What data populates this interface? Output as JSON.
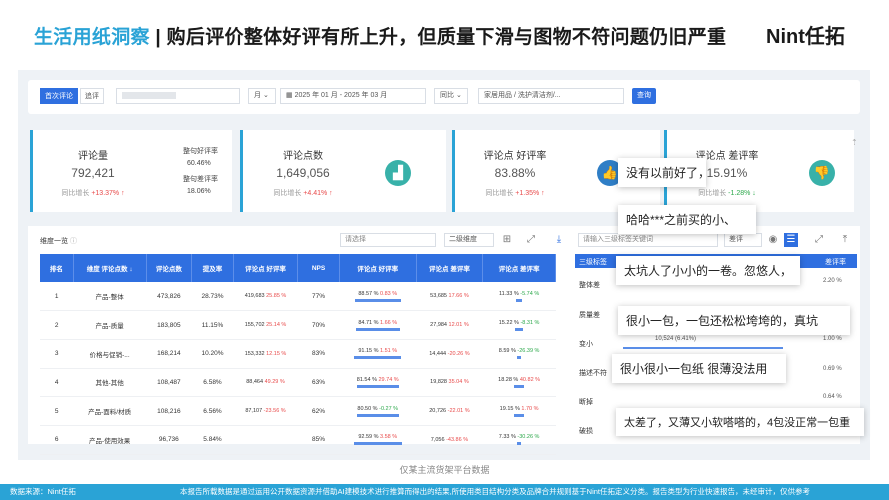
{
  "header": {
    "title_highlight": "生活用纸洞察",
    "title_sep": "|",
    "title_rest": "购后评价整体好评有所上升，但质量下滑与图物不符问题仍旧严重",
    "logo": "Nint任拓"
  },
  "filters": {
    "tab_first": "首次评论",
    "tab_follow": "追评",
    "period": "月",
    "date_start": "2025 年 01 月",
    "date_sep": "-",
    "date_end": "2025 年 03 月",
    "compare": "同比",
    "category": "家居用品 / 洗护清洁剂/...",
    "query_button": "查询"
  },
  "cards": [
    {
      "title": "评论量",
      "value": "792,421",
      "compare_label": "同比增长",
      "compare_value": "+13.37%",
      "trend": "up",
      "side": [
        {
          "label": "整句好评率",
          "value": "60.46%"
        },
        {
          "label": "整句差评率",
          "value": "18.06%"
        }
      ]
    },
    {
      "title": "评论点数",
      "value": "1,649,056",
      "compare_label": "同比增长",
      "compare_value": "+4.41%",
      "trend": "up",
      "icon": "chart-icon"
    },
    {
      "title": "评论点 好评率",
      "value": "83.88%",
      "compare_label": "同比增长",
      "compare_value": "+1.35%",
      "trend": "up",
      "icon": "thumbs-up-icon"
    },
    {
      "title": "评论点 差评率",
      "value": "15.91%",
      "compare_label": "同比增长",
      "compare_value": "-1.28%",
      "trend": "down",
      "icon": "thumbs-down-icon"
    }
  ],
  "table": {
    "section_label": "维度一览",
    "select_placeholder": "请选择",
    "dimension_select": "二级维度",
    "columns": [
      "排名",
      "维度 评论点数",
      "评论点数",
      "提及率",
      "评论点 好评率",
      "NPS",
      "评论点 好评率",
      "评论点 差评率",
      "评论点 差评率"
    ],
    "rows": [
      {
        "rank": "1",
        "name": "产品-整体",
        "count": "473,826",
        "mention": "28.73%",
        "good_cnt": "419,683",
        "good_rate": "25.85 %",
        "nps": "77%",
        "good_bar": "88.57 %",
        "good_delta": "0.83 %",
        "bad_cnt": "53,685",
        "bad_rate": "17.66 %",
        "bad_bar": "11.33 %",
        "bad_delta": "-5.74 %"
      },
      {
        "rank": "2",
        "name": "产品-质量",
        "count": "183,805",
        "mention": "11.15%",
        "good_cnt": "155,702",
        "good_rate": "25.14 %",
        "nps": "70%",
        "good_bar": "84.71 %",
        "good_delta": "1.66 %",
        "bad_cnt": "27,984",
        "bad_rate": "12.01 %",
        "bad_bar": "15.22 %",
        "bad_delta": "-8.31 %"
      },
      {
        "rank": "3",
        "name": "价格与促销-...",
        "count": "168,214",
        "mention": "10.20%",
        "good_cnt": "153,332",
        "good_rate": "12.15 %",
        "nps": "83%",
        "good_bar": "91.15 %",
        "good_delta": "1.51 %",
        "bad_cnt": "14,444",
        "bad_rate": "-20.26 %",
        "bad_bar": "8.59 %",
        "bad_delta": "-26.39 %"
      },
      {
        "rank": "4",
        "name": "其他-其他",
        "count": "108,487",
        "mention": "6.58%",
        "good_cnt": "88,464",
        "good_rate": "49.29 %",
        "nps": "63%",
        "good_bar": "81.54 %",
        "good_delta": "29.74 %",
        "bad_cnt": "19,828",
        "bad_rate": "35.04 %",
        "bad_bar": "18.28 %",
        "bad_delta": "40.82 %"
      },
      {
        "rank": "5",
        "name": "产品-面料/材质",
        "count": "108,216",
        "mention": "6.56%",
        "good_cnt": "87,107",
        "good_rate": "-23.56 %",
        "nps": "62%",
        "good_bar": "80.50 %",
        "good_delta": "-0.27 %",
        "bad_cnt": "20,726",
        "bad_rate": "-22.01 %",
        "bad_bar": "19.15 %",
        "bad_delta": "1.70 %"
      },
      {
        "rank": "6",
        "name": "产品-使用效果",
        "count": "96,736",
        "mention": "5.84%",
        "good_cnt": "",
        "good_rate": "",
        "nps": "85%",
        "good_bar": "92.59 %",
        "good_delta": "3.58 %",
        "bad_cnt": "7,056",
        "bad_rate": "-43.86 %",
        "bad_bar": "7.33 %",
        "bad_delta": "-30.26 %"
      }
    ]
  },
  "right_panel": {
    "search_placeholder": "请输入三级标签关键词",
    "sort_select": "差评",
    "header_label": "三级标签",
    "header_right": "差评率",
    "rows": [
      {
        "label": "整体差",
        "value": "2.20 %"
      },
      {
        "label": "质量差",
        "value": ""
      },
      {
        "label": "变小",
        "value": "1.00 %",
        "sub": "10,524 (6.41%)"
      },
      {
        "label": "描述不符",
        "value": "0.69 %"
      },
      {
        "label": "断掉",
        "value": "0.64 %"
      },
      {
        "label": "破损",
        "value": ""
      }
    ]
  },
  "bubbles": [
    "没有以前好了，",
    "哈哈***之前买的小、",
    "太坑人了小小的一卷。忽悠人，",
    "很小一包，一包还松松垮垮的，真坑",
    "很小很小一包纸 很薄没法用",
    "太差了，又薄又小软嗒嗒的，4包没正常一包重"
  ],
  "source_note": "仅某主流货架平台数据",
  "footer": {
    "source_label": "数据来源：Nint任拓",
    "disclaimer": "本报告所载数据是通过运用公开数据资源并借助AI建模技术进行推算而得出的结果,所使用类目结构分类及品牌合并规则基于Nint任拓定义分类。报告类型为行业快速报告，未经审计，仅供参考"
  },
  "colors": {
    "accent": "#2aa3d6",
    "primary": "#2f6fe0",
    "up": "#e84a4a",
    "down": "#2ba84a",
    "teal": "#38b1a9"
  }
}
